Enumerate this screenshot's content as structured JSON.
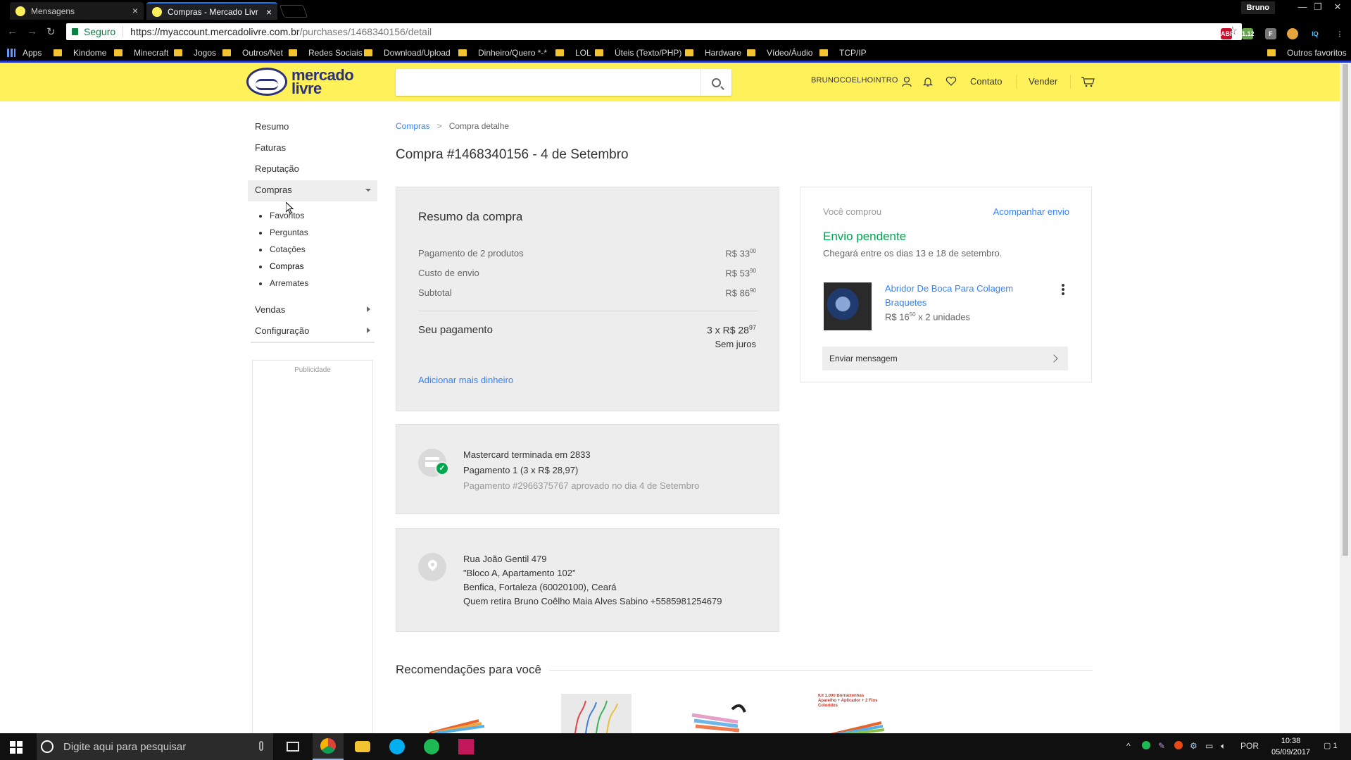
{
  "browser": {
    "tabs": [
      {
        "label": "Mensagens"
      },
      {
        "label": "Compras - Mercado Livr"
      }
    ],
    "user_badge": "Bruno",
    "security_label": "Seguro",
    "url_host": "https://myaccount.mercadolivre.com.br",
    "url_path": "/purchases/1468340156/detail",
    "extensions": [
      {
        "name": "abp-icon",
        "text": "ABP",
        "color": "#c70d2c"
      },
      {
        "name": "android-icon",
        "text": "1.12",
        "color": "#6aa84f"
      },
      {
        "name": "extension-f-icon",
        "text": "F",
        "color": "#777777"
      },
      {
        "name": "cookie-icon",
        "text": "",
        "color": "#e8a33d"
      },
      {
        "name": "iq-icon",
        "text": "IQ",
        "color": "#000000"
      }
    ],
    "bookmarks": [
      "Apps",
      "Kindome",
      "Minecraft",
      "Jogos",
      "Outros/Net",
      "Redes Sociais",
      "Download/Upload",
      "Dinheiro/Quero *-*",
      "LOL",
      "Úteis (Texto/PHP)",
      "Hardware",
      "Vídeo/Áudio",
      "TCP/IP"
    ],
    "other_bookmarks": "Outros favoritos"
  },
  "header": {
    "logo_line1": "mercado",
    "logo_line2": "livre",
    "search_placeholder": "",
    "username": "BRUNOCOELHOINTRO",
    "contact": "Contato",
    "sell": "Vender",
    "brand_color": "#fff159"
  },
  "sidebar": {
    "items": [
      "Resumo",
      "Faturas",
      "Reputação",
      "Compras"
    ],
    "subitems": [
      "Favoritos",
      "Perguntas",
      "Cotações",
      "Compras",
      "Arremates"
    ],
    "more_items": [
      "Vendas",
      "Configuração"
    ],
    "ad_label": "Publicidade"
  },
  "breadcrumb": {
    "parent": "Compras",
    "separator": ">",
    "current": "Compra detalhe"
  },
  "page_title": "Compra #1468340156 - 4 de Setembro",
  "summary": {
    "title": "Resumo da compra",
    "rows": [
      {
        "label": "Pagamento de 2 produtos",
        "value_main": "R$ 33",
        "value_cents": "00"
      },
      {
        "label": "Custo de envio",
        "value_main": "R$ 53",
        "value_cents": "90"
      },
      {
        "label": "Subtotal",
        "value_main": "R$ 86",
        "value_cents": "90"
      }
    ],
    "payment_label": "Seu pagamento",
    "payment_value_main": "3 x R$ 28",
    "payment_value_cents": "97",
    "payment_note": "Sem juros",
    "add_money": "Adicionar mais dinheiro"
  },
  "payment": {
    "card": "Mastercard terminada em 2833",
    "installment": "Pagamento 1 (3 x R$ 28,97)",
    "approval": "Pagamento #2966375767 aprovado no dia 4 de Setembro"
  },
  "address": {
    "street": "Rua João Gentil 479",
    "complement": "\"Bloco A, Apartamento 102\"",
    "city": "Benfica, Fortaleza (60020100), Ceará",
    "pickup": "Quem retira Bruno Coêlho Maia Alves Sabino +5585981254679"
  },
  "purchase": {
    "label": "Você comprou",
    "track": "Acompanhar envio",
    "status": "Envio pendente",
    "eta": "Chegará entre os dias 13 e 18 de setembro.",
    "product_name": "Abridor De Boca Para Colagem Braquetes",
    "price_main": "R$ 16",
    "price_cents": "50",
    "quantity": "x 2 unidades",
    "message": "Enviar mensagem"
  },
  "recommendations": {
    "title": "Recomendações para você",
    "item4_caption": "Kit 1.000 Borrachinhas Aparelho + Aplicador + 2 Fios Coloridos"
  },
  "taskbar": {
    "search_placeholder": "Digite aqui para pesquisar",
    "language": "POR",
    "time": "10:38",
    "date": "05/09/2017",
    "notifications": "1"
  }
}
